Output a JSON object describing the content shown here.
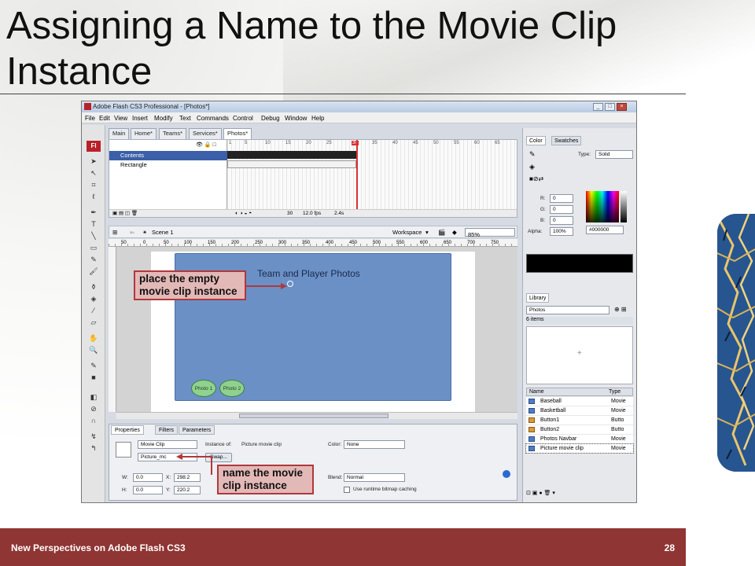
{
  "slide": {
    "title": "Assigning a Name to the Movie Clip Instance",
    "footer_text": "New Perspectives on Adobe Flash CS3",
    "page_number": "28"
  },
  "app": {
    "window_title": "Adobe Flash CS3 Professional - [Photos*]",
    "logo": "Fl",
    "menu": [
      "File",
      "Edit",
      "View",
      "Insert",
      "Modify",
      "Text",
      "Commands",
      "Control",
      "Debug",
      "Window",
      "Help"
    ],
    "doc_tabs": [
      "Main",
      "Home*",
      "Teams*",
      "Services*",
      "Photos*"
    ],
    "active_doc_tab": "Photos*",
    "timeline": {
      "layers": [
        {
          "name": "Contents",
          "selected": true
        },
        {
          "name": "Rectangle",
          "selected": false
        }
      ],
      "frame_numbers": [
        "1",
        "5",
        "10",
        "15",
        "20",
        "25",
        "30",
        "35",
        "40",
        "45",
        "50",
        "55",
        "60",
        "65"
      ],
      "current_frame": "30",
      "frame_rate": "12.0 fps",
      "elapsed": "2.4s"
    },
    "edit_bar": {
      "scene": "Scene 1",
      "workspace_label": "Workspace",
      "zoom": "85%"
    },
    "ruler_marks": [
      "50",
      "0",
      "50",
      "100",
      "150",
      "200",
      "250",
      "300",
      "350",
      "400",
      "450",
      "500",
      "550",
      "600",
      "650",
      "700",
      "750"
    ],
    "stage": {
      "heading": "Team and Player Photos",
      "buttons": [
        "Photo 1",
        "Photo 2"
      ]
    },
    "properties": {
      "tabs": [
        "Properties",
        "Filters",
        "Parameters"
      ],
      "symbol_type": "Movie Clip",
      "instance_of_label": "Instance of:",
      "instance_of_value": "Picture movie clip",
      "instance_name": "Picture_mc",
      "swap_button": "Swap...",
      "color_label": "Color:",
      "color_value": "None",
      "blend_label": "Blend:",
      "blend_value": "Normal",
      "bitmap_caching": "Use runtime bitmap caching",
      "w_label": "W:",
      "w_value": "0.0",
      "h_label": "H:",
      "h_value": "0.0",
      "x_label": "X:",
      "x_value": "298.2",
      "y_label": "Y:",
      "y_value": "220.2"
    },
    "color_panel": {
      "tabs": [
        "Color",
        "Swatches"
      ],
      "type_label": "Type:",
      "type_value": "Solid",
      "r_label": "R:",
      "r_value": "0",
      "g_label": "G:",
      "g_value": "0",
      "b_label": "B:",
      "b_value": "0",
      "alpha_label": "Alpha:",
      "alpha_value": "100%",
      "hex": "#000000"
    },
    "library": {
      "tab": "Library",
      "doc": "Photos",
      "count": "6 items",
      "col_name": "Name",
      "col_type": "Type",
      "items": [
        {
          "name": "Baseball",
          "type": "Movie"
        },
        {
          "name": "Basketball",
          "type": "Movie"
        },
        {
          "name": "Button1",
          "type": "Butto"
        },
        {
          "name": "Button2",
          "type": "Butto"
        },
        {
          "name": "Photos Navbar",
          "type": "Movie"
        },
        {
          "name": "Picture movie clip",
          "type": "Movie"
        }
      ]
    }
  },
  "callouts": {
    "place": "place the empty movie clip instance",
    "name": "name the movie clip instance"
  },
  "colors": {
    "footer": "#8f3533",
    "callout_border": "#b0383c",
    "callout_fill": "#e3b9b7",
    "stage_blue": "#6b90c6"
  }
}
